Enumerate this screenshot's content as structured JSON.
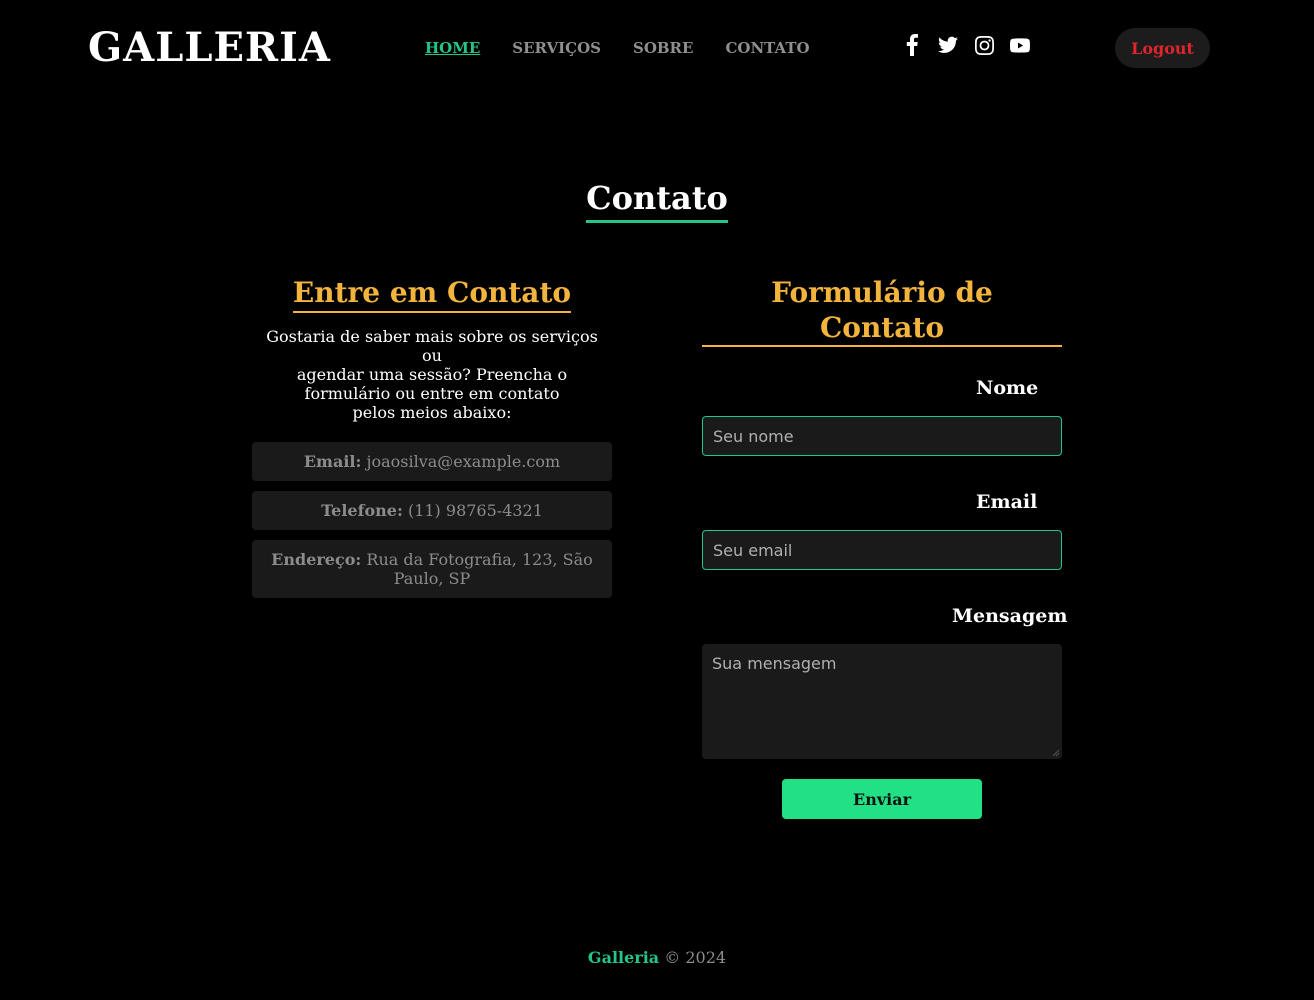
{
  "header": {
    "logo": "GALLERIA",
    "nav": [
      {
        "label": "HOME",
        "active": true
      },
      {
        "label": "SERVIÇOS",
        "active": false
      },
      {
        "label": "SOBRE",
        "active": false
      },
      {
        "label": "CONTATO",
        "active": false
      }
    ],
    "socials": [
      "facebook-icon",
      "twitter-icon",
      "instagram-icon",
      "youtube-icon"
    ],
    "logout_label": "Logout"
  },
  "page_title": "Contato",
  "contact_info": {
    "heading": "Entre em Contato",
    "intro_line1": "Gostaria de saber mais sobre os serviços ou",
    "intro_line2": "agendar uma sessão? Preencha o",
    "intro_line3": "formulário ou entre em contato",
    "intro_line4": "pelos meios abaixo:",
    "email_label": "Email:",
    "email_value": "joaosilva@example.com",
    "phone_label": "Telefone:",
    "phone_value": "(11) 98765-4321",
    "address_label": "Endereço:",
    "address_value": "Rua da Fotografia, 123, São Paulo, SP"
  },
  "form": {
    "heading_line1": "Formulário de",
    "heading_line2": "Contato",
    "name_label": "Nome",
    "name_placeholder": "Seu nome",
    "email_label": "Email",
    "email_placeholder": "Seu email",
    "message_label": "Mensagem",
    "message_placeholder": "Sua mensagem",
    "submit_label": "Enviar"
  },
  "footer": {
    "brand": "Galleria",
    "copyright": "© 2024"
  },
  "colors": {
    "background": "#000000",
    "accent_green": "#22c58a",
    "heading_gold": "#f2b43c",
    "logout_red": "#e0242c",
    "button_green": "#22e084"
  }
}
